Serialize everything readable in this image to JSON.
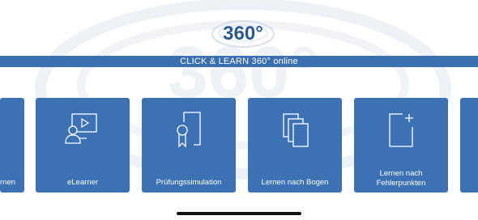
{
  "app": {
    "logo_text": "360°",
    "banner_title": "CLICK & LEARN 360° online"
  },
  "tiles": [
    {
      "label": "rnen",
      "icon": "partial-tile"
    },
    {
      "label": "eLearner",
      "icon": "elearner-presentation-icon"
    },
    {
      "label": "Prüfungssimulation",
      "icon": "certificate-icon"
    },
    {
      "label": "Lernen nach Bogen",
      "icon": "documents-stack-icon"
    },
    {
      "label_line1": "Lernen nach",
      "label_line2": "Fehlerpunkten",
      "icon": "document-add-icon"
    },
    {
      "label": "",
      "icon": "partial-tile"
    }
  ],
  "colors": {
    "tile_blue": "#3c72b4",
    "banner_blue": "#3a6fb0",
    "logo_blue": "#2a5a95",
    "background": "#ffffff"
  }
}
